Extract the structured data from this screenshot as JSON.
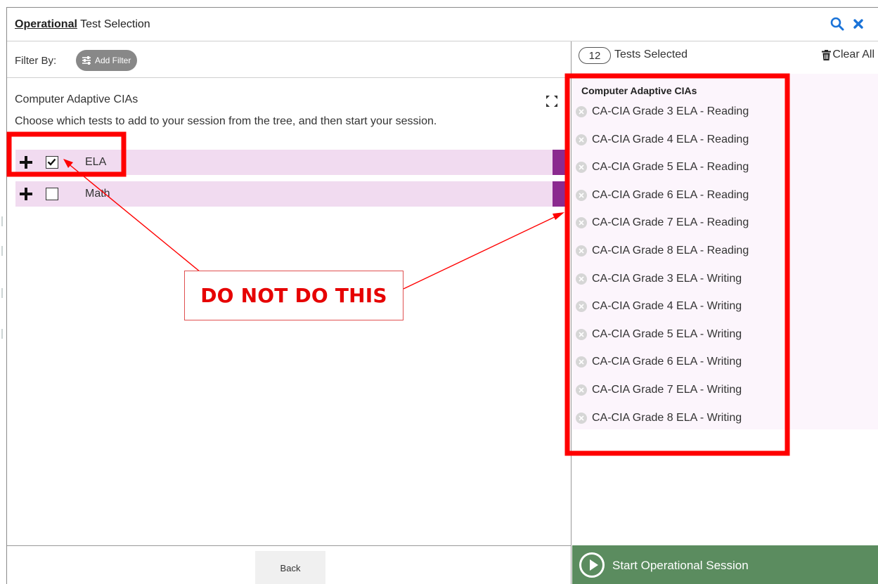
{
  "modal": {
    "title_emph": "Operational",
    "title_rest": " Test Selection"
  },
  "filter": {
    "label": "Filter By:",
    "add_filter_label": "Add Filter"
  },
  "tree": {
    "section_title": "Computer Adaptive CIAs",
    "instructions": "Choose which tests to add to your session from the tree, and then start your session.",
    "rows": [
      {
        "label": "ELA",
        "checked": true
      },
      {
        "label": "Math",
        "checked": false
      }
    ]
  },
  "selection": {
    "count": "12",
    "label": "Tests Selected",
    "clear_all_label": "Clear All",
    "group_title": "Computer Adaptive CIAs",
    "items": [
      "CA-CIA Grade 3 ELA - Reading",
      "CA-CIA Grade 4 ELA - Reading",
      "CA-CIA Grade 5 ELA - Reading",
      "CA-CIA Grade 6 ELA - Reading",
      "CA-CIA Grade 7 ELA - Reading",
      "CA-CIA Grade 8 ELA - Reading",
      "CA-CIA Grade 3 ELA - Writing",
      "CA-CIA Grade 4 ELA - Writing",
      "CA-CIA Grade 5 ELA - Writing",
      "CA-CIA Grade 6 ELA - Writing",
      "CA-CIA Grade 7 ELA - Writing",
      "CA-CIA Grade 8 ELA - Writing"
    ]
  },
  "footer": {
    "back_label": "Back",
    "start_label": "Start Operational Session"
  },
  "annotation": {
    "callout_text": "DO NOT DO THIS"
  },
  "colors": {
    "tree_row_bg": "#f1dbf0",
    "tree_row_end": "#8b2a8f",
    "start_button_bg": "#5b8c5f",
    "icon_blue": "#1a73d8",
    "annotation_red": "#ff0000"
  }
}
